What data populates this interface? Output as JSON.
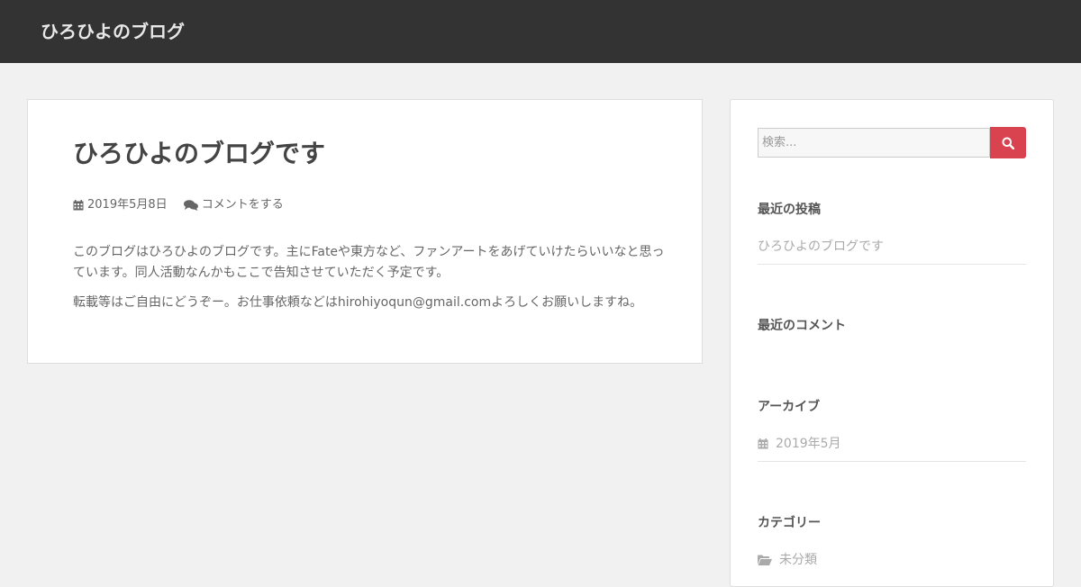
{
  "header": {
    "site_title": "ひろひよのブログ"
  },
  "post": {
    "title": "ひろひよのブログです",
    "date": "2019年5月8日",
    "comment_link": "コメントをする",
    "paragraphs": [
      "このブログはひろひよのブログです。主にFateや東方など、ファンアートをあげていけたらいいなと思っています。同人活動なんかもここで告知させていただく予定です。",
      "転載等はご自由にどうぞー。お仕事依頼などはhirohiyoqun@gmail.comよろしくお願いしますね。"
    ]
  },
  "sidebar": {
    "search_placeholder": "検索...",
    "recent_posts": {
      "title": "最近の投稿",
      "items": [
        "ひろひよのブログです"
      ]
    },
    "recent_comments": {
      "title": "最近のコメント"
    },
    "archives": {
      "title": "アーカイブ",
      "items": [
        "2019年5月"
      ]
    },
    "categories": {
      "title": "カテゴリー",
      "items": [
        "未分類"
      ]
    }
  },
  "colors": {
    "header_bg": "#333333",
    "page_bg": "#f1f1f1",
    "accent": "#d9434f"
  }
}
